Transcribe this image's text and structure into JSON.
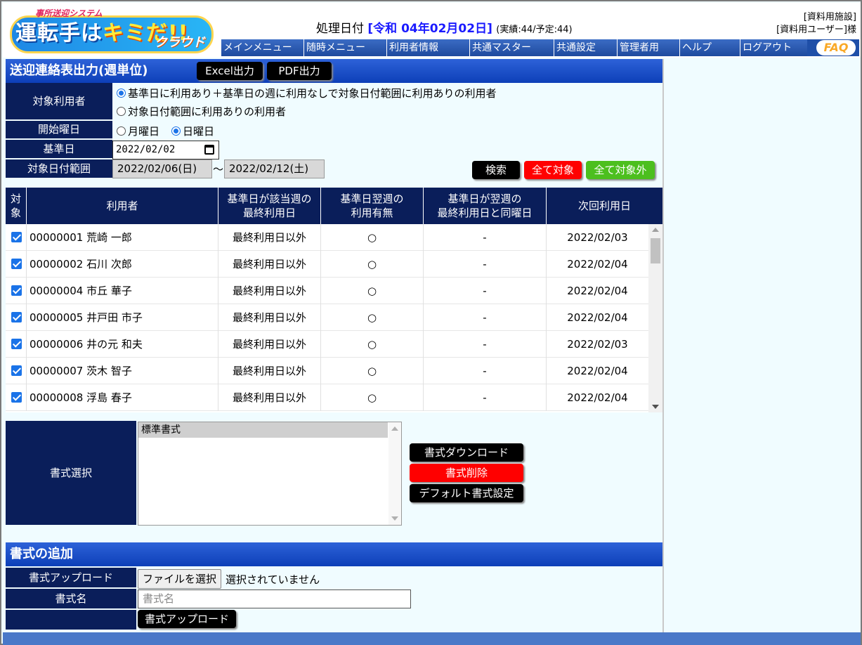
{
  "header": {
    "logo_small": "事所送迎システム",
    "logo_main_1": "運転手は",
    "logo_main_2": "キミ",
    "logo_main_3": "だ!!",
    "logo_cloud": "クラウド",
    "proc_label": "処理日付",
    "proc_date": "[令和 04年02月02日]",
    "proc_counts": "(実績:44/予定:44)",
    "facility": "[資料用施設]",
    "user": "[資料用ユーザー]様"
  },
  "menu": [
    {
      "label": "メインメニュー"
    },
    {
      "label": "随時メニュー"
    },
    {
      "label": "利用者情報"
    },
    {
      "label": "共通マスター"
    },
    {
      "label": "共通設定"
    },
    {
      "label": "管理者用"
    },
    {
      "label": "ヘルプ"
    },
    {
      "label": "ログアウト"
    }
  ],
  "faq": "FAQ",
  "page": {
    "title": "送迎連絡表出力(週単位)",
    "excel_button": "Excel出力",
    "pdf_button": "PDF出力"
  },
  "filters": {
    "target_label": "対象利用者",
    "target_options": [
      {
        "label": "基準日に利用あり＋基準日の週に利用なしで対象日付範囲に利用ありの利用者",
        "selected": true
      },
      {
        "label": "対象日付範囲に利用ありの利用者",
        "selected": false
      }
    ],
    "weekday_label": "開始曜日",
    "weekday_options": [
      {
        "label": "月曜日",
        "selected": false
      },
      {
        "label": "日曜日",
        "selected": true
      }
    ],
    "base_date_label": "基準日",
    "base_date_value": "2022/02/02",
    "range_label": "対象日付範囲",
    "range_from": "2022/02/06(日)",
    "range_sep": "～",
    "range_to": "2022/02/12(土)",
    "search_button": "検索",
    "select_all_button": "全て対象",
    "deselect_all_button": "全て対象外"
  },
  "table": {
    "headers": {
      "target_1": "対",
      "target_2": "象",
      "user": "利用者",
      "last_use_1": "基準日が該当週の",
      "last_use_2": "最終利用日",
      "next_week_1": "基準日翌週の",
      "next_week_2": "利用有無",
      "same_weekday_1": "基準日が翌週の",
      "same_weekday_2": "最終利用日と同曜日",
      "next_date": "次回利用日"
    },
    "rows": [
      {
        "user": "00000001 荒崎 一郎",
        "last_use": "最終利用日以外",
        "next_week": "○",
        "same_weekday": "-",
        "next_date": "2022/02/03"
      },
      {
        "user": "00000002 石川 次郎",
        "last_use": "最終利用日以外",
        "next_week": "○",
        "same_weekday": "-",
        "next_date": "2022/02/04"
      },
      {
        "user": "00000004 市丘 華子",
        "last_use": "最終利用日以外",
        "next_week": "○",
        "same_weekday": "-",
        "next_date": "2022/02/04"
      },
      {
        "user": "00000005 井戸田 市子",
        "last_use": "最終利用日以外",
        "next_week": "○",
        "same_weekday": "-",
        "next_date": "2022/02/04"
      },
      {
        "user": "00000006 井の元 和夫",
        "last_use": "最終利用日以外",
        "next_week": "○",
        "same_weekday": "-",
        "next_date": "2022/02/03"
      },
      {
        "user": "00000007 茨木 智子",
        "last_use": "最終利用日以外",
        "next_week": "○",
        "same_weekday": "-",
        "next_date": "2022/02/04"
      },
      {
        "user": "00000008 浮島 春子",
        "last_use": "最終利用日以外",
        "next_week": "○",
        "same_weekday": "-",
        "next_date": "2022/02/04"
      }
    ]
  },
  "format": {
    "label": "書式選択",
    "selected_option": "標準書式",
    "download_button": "書式ダウンロード",
    "delete_button": "書式削除",
    "default_button": "デフォルト書式設定"
  },
  "add_format": {
    "title": "書式の追加",
    "upload_label": "書式アップロード",
    "file_button": "ファイルを選択",
    "file_status": "選択されていません",
    "name_label": "書式名",
    "name_placeholder": "書式名",
    "upload_button": "書式アップロード"
  }
}
